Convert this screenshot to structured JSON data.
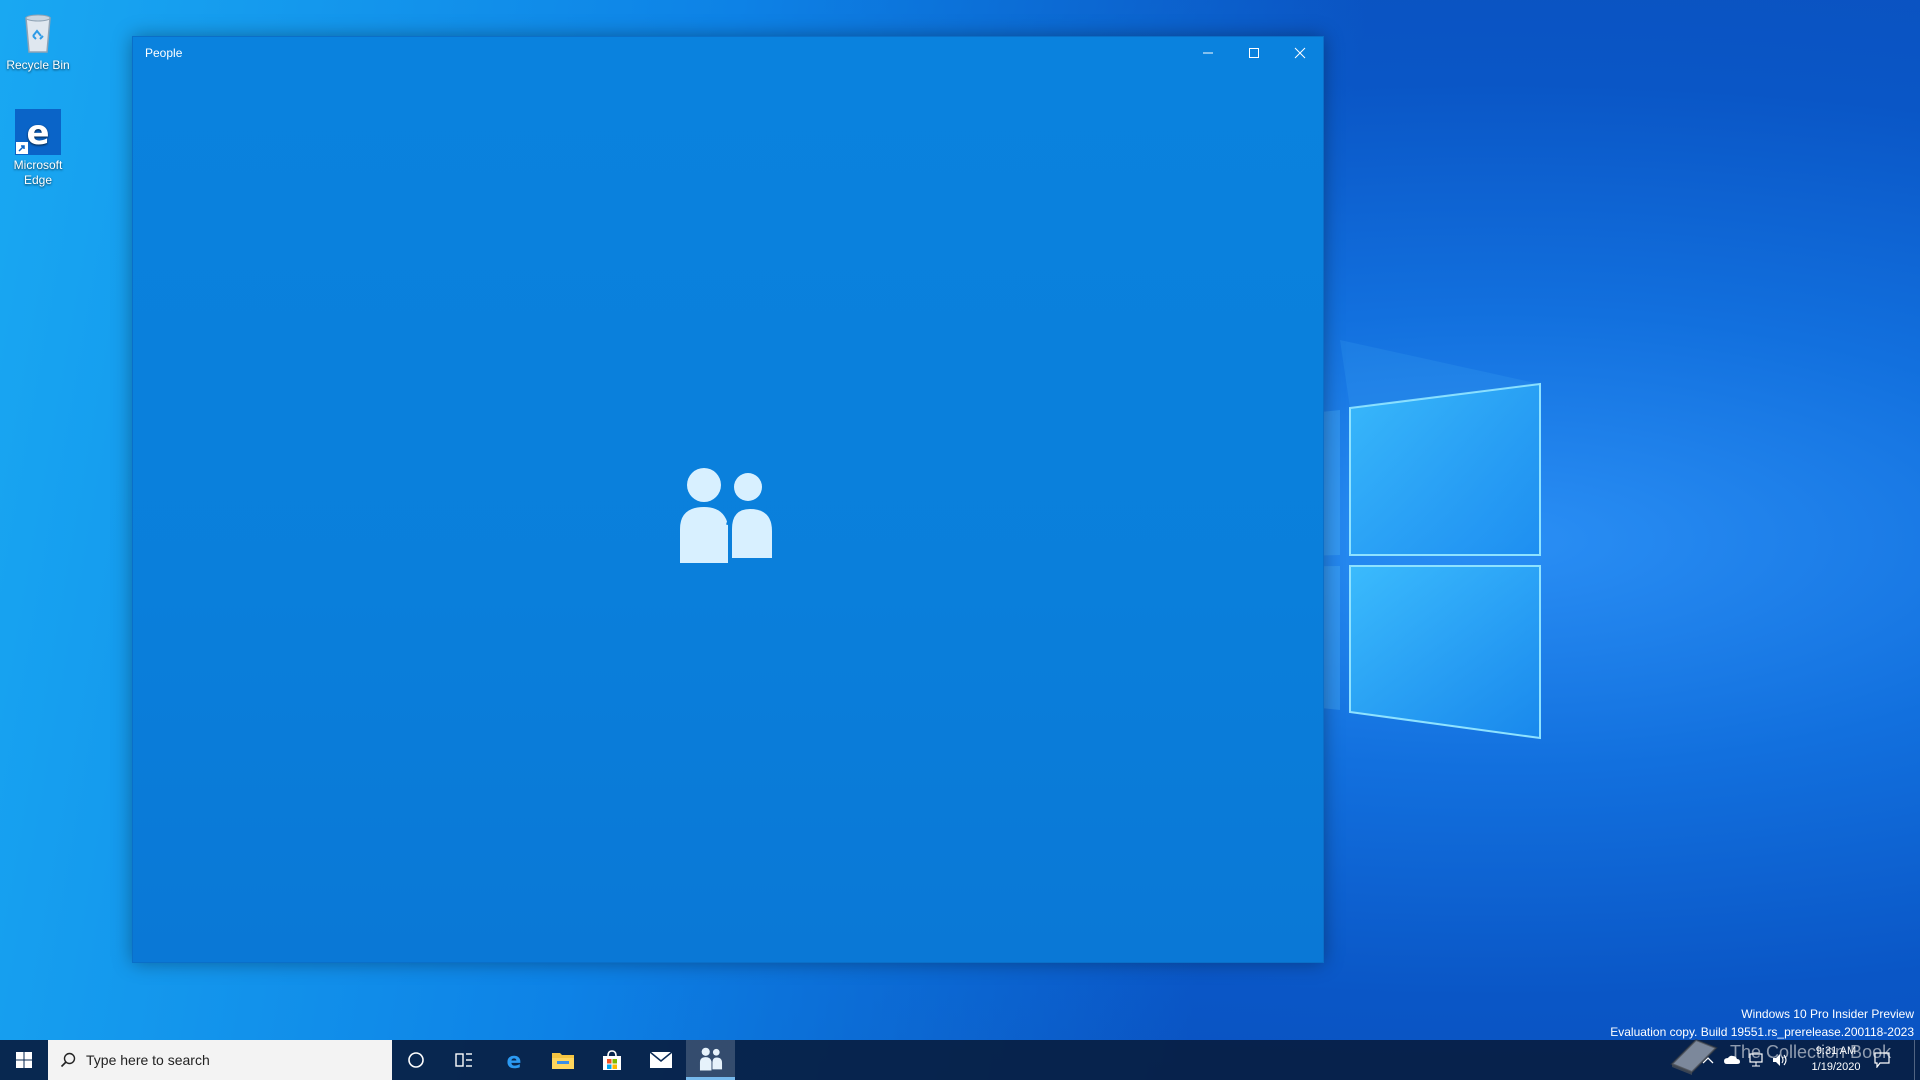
{
  "desktop": {
    "icons": [
      {
        "label": "Recycle Bin"
      },
      {
        "label": "Microsoft Edge"
      }
    ]
  },
  "window": {
    "title": "People",
    "controls": [
      "minimize",
      "maximize",
      "close"
    ]
  },
  "taskbar": {
    "search_placeholder": "Type here to search",
    "apps": [
      "cortana-icon",
      "task-view-icon",
      "edge-icon",
      "file-explorer-icon",
      "store-icon",
      "mail-icon",
      "people-icon"
    ],
    "active_app": "people-icon"
  },
  "system": {
    "edition": "Windows 10 Pro Insider Preview",
    "build": "Evaluation copy. Build 19551.rs_prerelease.200118-2023",
    "time": "9:31 AM",
    "date": "1/19/2020",
    "watermark": "The Collection Book"
  },
  "colors": {
    "accent": "#0a7fdb",
    "taskbar": "#0a2a56",
    "search_bg": "#f3f3f3"
  }
}
